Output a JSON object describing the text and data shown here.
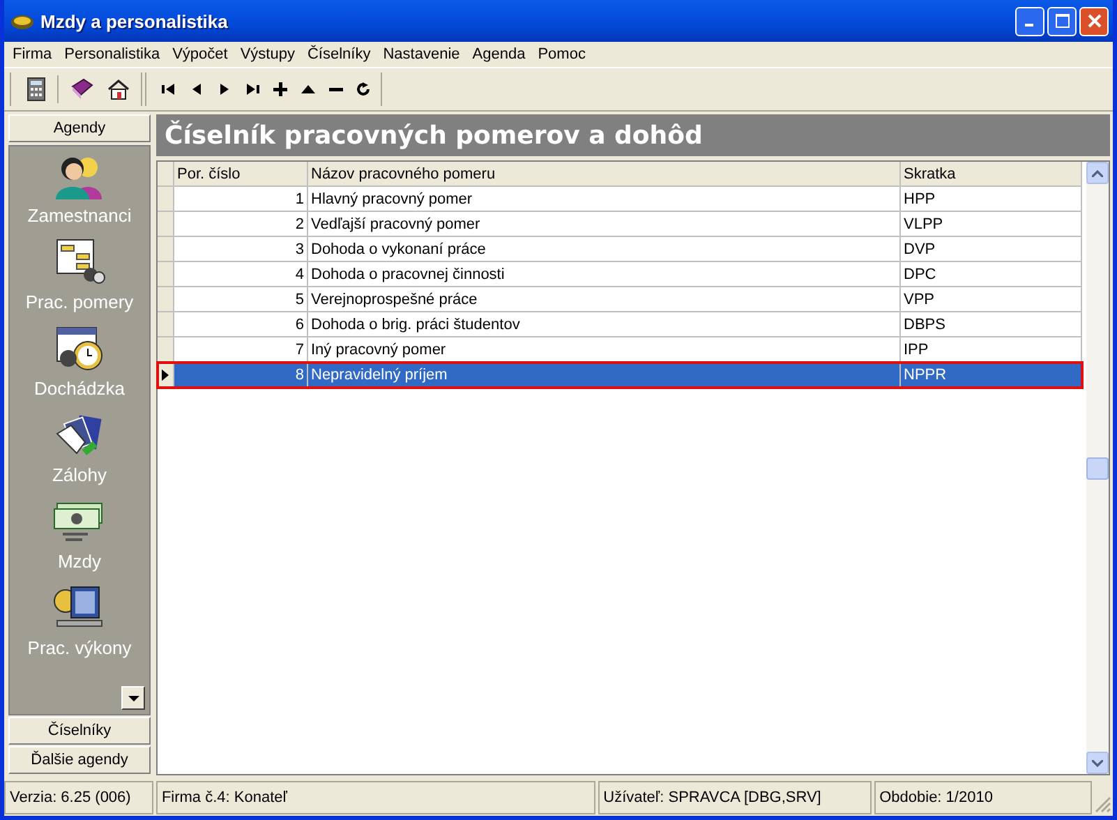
{
  "window": {
    "title": "Mzdy a personalistika"
  },
  "menu": [
    "Firma",
    "Personalistika",
    "Výpočet",
    "Výstupy",
    "Číselníky",
    "Nastavenie",
    "Agenda",
    "Pomoc"
  ],
  "sidebar": {
    "header": "Agendy",
    "items": [
      {
        "label": "Zamestnanci"
      },
      {
        "label": "Prac. pomery"
      },
      {
        "label": "Dochádzka"
      },
      {
        "label": "Zálohy"
      },
      {
        "label": "Mzdy"
      },
      {
        "label": "Prac. výkony"
      }
    ],
    "bottom_buttons": [
      "Číselníky",
      "Ďalšie agendy"
    ]
  },
  "heading": "Číselník pracovných pomerov a dohôd",
  "table": {
    "columns": [
      "Por. číslo",
      "Názov pracovného pomeru",
      "Skratka"
    ],
    "rows": [
      {
        "cells": [
          "1",
          "Hlavný pracovný pomer",
          "HPP"
        ],
        "selected": false
      },
      {
        "cells": [
          "2",
          "Vedľajší pracovný pomer",
          "VLPP"
        ],
        "selected": false
      },
      {
        "cells": [
          "3",
          "Dohoda o vykonaní práce",
          "DVP"
        ],
        "selected": false
      },
      {
        "cells": [
          "4",
          "Dohoda o pracovnej činnosti",
          "DPC"
        ],
        "selected": false
      },
      {
        "cells": [
          "5",
          "Verejnoprospešné práce",
          "VPP"
        ],
        "selected": false
      },
      {
        "cells": [
          "6",
          "Dohoda o brig. práci študentov",
          "DBPS"
        ],
        "selected": false
      },
      {
        "cells": [
          "7",
          "Iný pracovný pomer",
          "IPP"
        ],
        "selected": false
      },
      {
        "cells": [
          "8",
          "Nepravidelný príjem",
          "NPPR"
        ],
        "selected": true
      }
    ]
  },
  "status_bar": [
    "Verzia: 6.25 (006)",
    "Firma č.4: Konateľ",
    "Užívateľ: SPRAVCA [DBG,SRV]",
    "Obdobie: 1/2010"
  ]
}
